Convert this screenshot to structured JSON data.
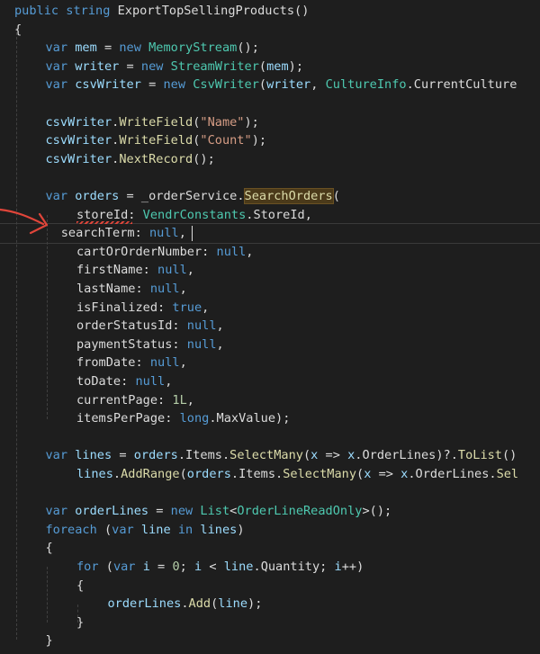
{
  "editor": {
    "lines": [
      {
        "indent": 0,
        "tokens": [
          {
            "t": "public",
            "c": "kw"
          },
          {
            "t": " "
          },
          {
            "t": "string",
            "c": "kw"
          },
          {
            "t": " "
          },
          {
            "t": "ExportTopSellingProducts",
            "c": "plain"
          },
          {
            "t": "()"
          }
        ]
      },
      {
        "indent": 0,
        "tokens": [
          {
            "t": "{"
          }
        ]
      },
      {
        "indent": 1,
        "tokens": [
          {
            "t": "var",
            "c": "kw"
          },
          {
            "t": " "
          },
          {
            "t": "mem",
            "c": "param"
          },
          {
            "t": " = "
          },
          {
            "t": "new",
            "c": "kw"
          },
          {
            "t": " "
          },
          {
            "t": "MemoryStream",
            "c": "type"
          },
          {
            "t": "();"
          }
        ]
      },
      {
        "indent": 1,
        "tokens": [
          {
            "t": "var",
            "c": "kw"
          },
          {
            "t": " "
          },
          {
            "t": "writer",
            "c": "param"
          },
          {
            "t": " = "
          },
          {
            "t": "new",
            "c": "kw"
          },
          {
            "t": " "
          },
          {
            "t": "StreamWriter",
            "c": "type"
          },
          {
            "t": "("
          },
          {
            "t": "mem",
            "c": "param"
          },
          {
            "t": ");"
          }
        ]
      },
      {
        "indent": 1,
        "tokens": [
          {
            "t": "var",
            "c": "kw"
          },
          {
            "t": " "
          },
          {
            "t": "csvWriter",
            "c": "param"
          },
          {
            "t": " = "
          },
          {
            "t": "new",
            "c": "kw"
          },
          {
            "t": " "
          },
          {
            "t": "CsvWriter",
            "c": "type"
          },
          {
            "t": "("
          },
          {
            "t": "writer",
            "c": "param"
          },
          {
            "t": ", "
          },
          {
            "t": "CultureInfo",
            "c": "type"
          },
          {
            "t": "."
          },
          {
            "t": "CurrentCulture",
            "c": "plain"
          }
        ]
      },
      {
        "indent": 0,
        "tokens": []
      },
      {
        "indent": 1,
        "tokens": [
          {
            "t": "csvWriter",
            "c": "param"
          },
          {
            "t": "."
          },
          {
            "t": "WriteField",
            "c": "method"
          },
          {
            "t": "("
          },
          {
            "t": "\"Name\"",
            "c": "str"
          },
          {
            "t": ");"
          }
        ]
      },
      {
        "indent": 1,
        "tokens": [
          {
            "t": "csvWriter",
            "c": "param"
          },
          {
            "t": "."
          },
          {
            "t": "WriteField",
            "c": "method"
          },
          {
            "t": "("
          },
          {
            "t": "\"Count\"",
            "c": "str"
          },
          {
            "t": ");"
          }
        ]
      },
      {
        "indent": 1,
        "tokens": [
          {
            "t": "csvWriter",
            "c": "param"
          },
          {
            "t": "."
          },
          {
            "t": "NextRecord",
            "c": "method"
          },
          {
            "t": "();"
          }
        ]
      },
      {
        "indent": 0,
        "tokens": []
      },
      {
        "indent": 1,
        "tokens": [
          {
            "t": "var",
            "c": "kw"
          },
          {
            "t": " "
          },
          {
            "t": "orders",
            "c": "param"
          },
          {
            "t": " = "
          },
          {
            "t": "_orderService",
            "c": "plain"
          },
          {
            "t": "."
          },
          {
            "t": "SearchOrders",
            "c": "method",
            "hl": true
          },
          {
            "t": "("
          }
        ]
      },
      {
        "indent": 2,
        "tokens": [
          {
            "t": "storeId",
            "c": "plain"
          },
          {
            "t": ": "
          },
          {
            "t": "VendrConstants",
            "c": "type"
          },
          {
            "t": "."
          },
          {
            "t": "StoreId",
            "c": "plain"
          },
          {
            "t": ","
          }
        ]
      },
      {
        "indent": 1.5,
        "tokens": [
          {
            "t": "searchTerm",
            "c": "plain"
          },
          {
            "t": ": "
          },
          {
            "t": "null",
            "c": "kw"
          },
          {
            "t": ","
          }
        ]
      },
      {
        "indent": 2,
        "tokens": [
          {
            "t": "cartOrOrderNumber",
            "c": "plain"
          },
          {
            "t": ": "
          },
          {
            "t": "null",
            "c": "kw"
          },
          {
            "t": ","
          }
        ]
      },
      {
        "indent": 2,
        "tokens": [
          {
            "t": "firstName",
            "c": "plain"
          },
          {
            "t": ": "
          },
          {
            "t": "null",
            "c": "kw"
          },
          {
            "t": ","
          }
        ]
      },
      {
        "indent": 2,
        "tokens": [
          {
            "t": "lastName",
            "c": "plain"
          },
          {
            "t": ": "
          },
          {
            "t": "null",
            "c": "kw"
          },
          {
            "t": ","
          }
        ]
      },
      {
        "indent": 2,
        "tokens": [
          {
            "t": "isFinalized",
            "c": "plain"
          },
          {
            "t": ": "
          },
          {
            "t": "true",
            "c": "kw"
          },
          {
            "t": ","
          }
        ]
      },
      {
        "indent": 2,
        "tokens": [
          {
            "t": "orderStatusId",
            "c": "plain"
          },
          {
            "t": ": "
          },
          {
            "t": "null",
            "c": "kw"
          },
          {
            "t": ","
          }
        ]
      },
      {
        "indent": 2,
        "tokens": [
          {
            "t": "paymentStatus",
            "c": "plain"
          },
          {
            "t": ": "
          },
          {
            "t": "null",
            "c": "kw"
          },
          {
            "t": ","
          }
        ]
      },
      {
        "indent": 2,
        "tokens": [
          {
            "t": "fromDate",
            "c": "plain"
          },
          {
            "t": ": "
          },
          {
            "t": "null",
            "c": "kw"
          },
          {
            "t": ","
          }
        ]
      },
      {
        "indent": 2,
        "tokens": [
          {
            "t": "toDate",
            "c": "plain"
          },
          {
            "t": ": "
          },
          {
            "t": "null",
            "c": "kw"
          },
          {
            "t": ","
          }
        ]
      },
      {
        "indent": 2,
        "tokens": [
          {
            "t": "currentPage",
            "c": "plain"
          },
          {
            "t": ": "
          },
          {
            "t": "1L",
            "c": "num"
          },
          {
            "t": ","
          }
        ]
      },
      {
        "indent": 2,
        "tokens": [
          {
            "t": "itemsPerPage",
            "c": "plain"
          },
          {
            "t": ": "
          },
          {
            "t": "long",
            "c": "kw"
          },
          {
            "t": "."
          },
          {
            "t": "MaxValue",
            "c": "plain"
          },
          {
            "t": ");"
          }
        ]
      },
      {
        "indent": 0,
        "tokens": []
      },
      {
        "indent": 1,
        "tokens": [
          {
            "t": "var",
            "c": "kw"
          },
          {
            "t": " "
          },
          {
            "t": "lines",
            "c": "param"
          },
          {
            "t": " = "
          },
          {
            "t": "orders",
            "c": "param"
          },
          {
            "t": "."
          },
          {
            "t": "Items",
            "c": "plain"
          },
          {
            "t": "."
          },
          {
            "t": "SelectMany",
            "c": "method"
          },
          {
            "t": "("
          },
          {
            "t": "x",
            "c": "param"
          },
          {
            "t": " => "
          },
          {
            "t": "x",
            "c": "param"
          },
          {
            "t": "."
          },
          {
            "t": "OrderLines",
            "c": "plain"
          },
          {
            "t": ")?."
          },
          {
            "t": "ToList",
            "c": "method"
          },
          {
            "t": "()"
          }
        ]
      },
      {
        "indent": 2,
        "tokens": [
          {
            "t": "lines",
            "c": "param"
          },
          {
            "t": "."
          },
          {
            "t": "AddRange",
            "c": "method"
          },
          {
            "t": "("
          },
          {
            "t": "orders",
            "c": "param"
          },
          {
            "t": "."
          },
          {
            "t": "Items",
            "c": "plain"
          },
          {
            "t": "."
          },
          {
            "t": "SelectMany",
            "c": "method"
          },
          {
            "t": "("
          },
          {
            "t": "x",
            "c": "param"
          },
          {
            "t": " => "
          },
          {
            "t": "x",
            "c": "param"
          },
          {
            "t": "."
          },
          {
            "t": "OrderLines",
            "c": "plain"
          },
          {
            "t": "."
          },
          {
            "t": "Sel",
            "c": "method"
          }
        ]
      },
      {
        "indent": 0,
        "tokens": []
      },
      {
        "indent": 1,
        "tokens": [
          {
            "t": "var",
            "c": "kw"
          },
          {
            "t": " "
          },
          {
            "t": "orderLines",
            "c": "param"
          },
          {
            "t": " = "
          },
          {
            "t": "new",
            "c": "kw"
          },
          {
            "t": " "
          },
          {
            "t": "List",
            "c": "type"
          },
          {
            "t": "<"
          },
          {
            "t": "OrderLineReadOnly",
            "c": "type"
          },
          {
            "t": ">();"
          }
        ]
      },
      {
        "indent": 1,
        "tokens": [
          {
            "t": "foreach",
            "c": "kw"
          },
          {
            "t": " ("
          },
          {
            "t": "var",
            "c": "kw"
          },
          {
            "t": " "
          },
          {
            "t": "line",
            "c": "param"
          },
          {
            "t": " "
          },
          {
            "t": "in",
            "c": "kw"
          },
          {
            "t": " "
          },
          {
            "t": "lines",
            "c": "param"
          },
          {
            "t": ")"
          }
        ]
      },
      {
        "indent": 1,
        "tokens": [
          {
            "t": "{"
          }
        ]
      },
      {
        "indent": 2,
        "tokens": [
          {
            "t": "for",
            "c": "kw"
          },
          {
            "t": " ("
          },
          {
            "t": "var",
            "c": "kw"
          },
          {
            "t": " "
          },
          {
            "t": "i",
            "c": "param"
          },
          {
            "t": " = "
          },
          {
            "t": "0",
            "c": "num"
          },
          {
            "t": "; "
          },
          {
            "t": "i",
            "c": "param"
          },
          {
            "t": " < "
          },
          {
            "t": "line",
            "c": "param"
          },
          {
            "t": "."
          },
          {
            "t": "Quantity",
            "c": "plain"
          },
          {
            "t": "; "
          },
          {
            "t": "i",
            "c": "param"
          },
          {
            "t": "++)"
          }
        ]
      },
      {
        "indent": 2,
        "tokens": [
          {
            "t": "{"
          }
        ]
      },
      {
        "indent": 3,
        "tokens": [
          {
            "t": "orderLines",
            "c": "param"
          },
          {
            "t": "."
          },
          {
            "t": "Add",
            "c": "method"
          },
          {
            "t": "("
          },
          {
            "t": "line",
            "c": "param"
          },
          {
            "t": ");"
          }
        ]
      },
      {
        "indent": 2,
        "tokens": [
          {
            "t": "}"
          }
        ]
      },
      {
        "indent": 1,
        "tokens": [
          {
            "t": "}"
          }
        ]
      }
    ]
  },
  "annotation": {
    "arrow_color": "#e0453a"
  }
}
